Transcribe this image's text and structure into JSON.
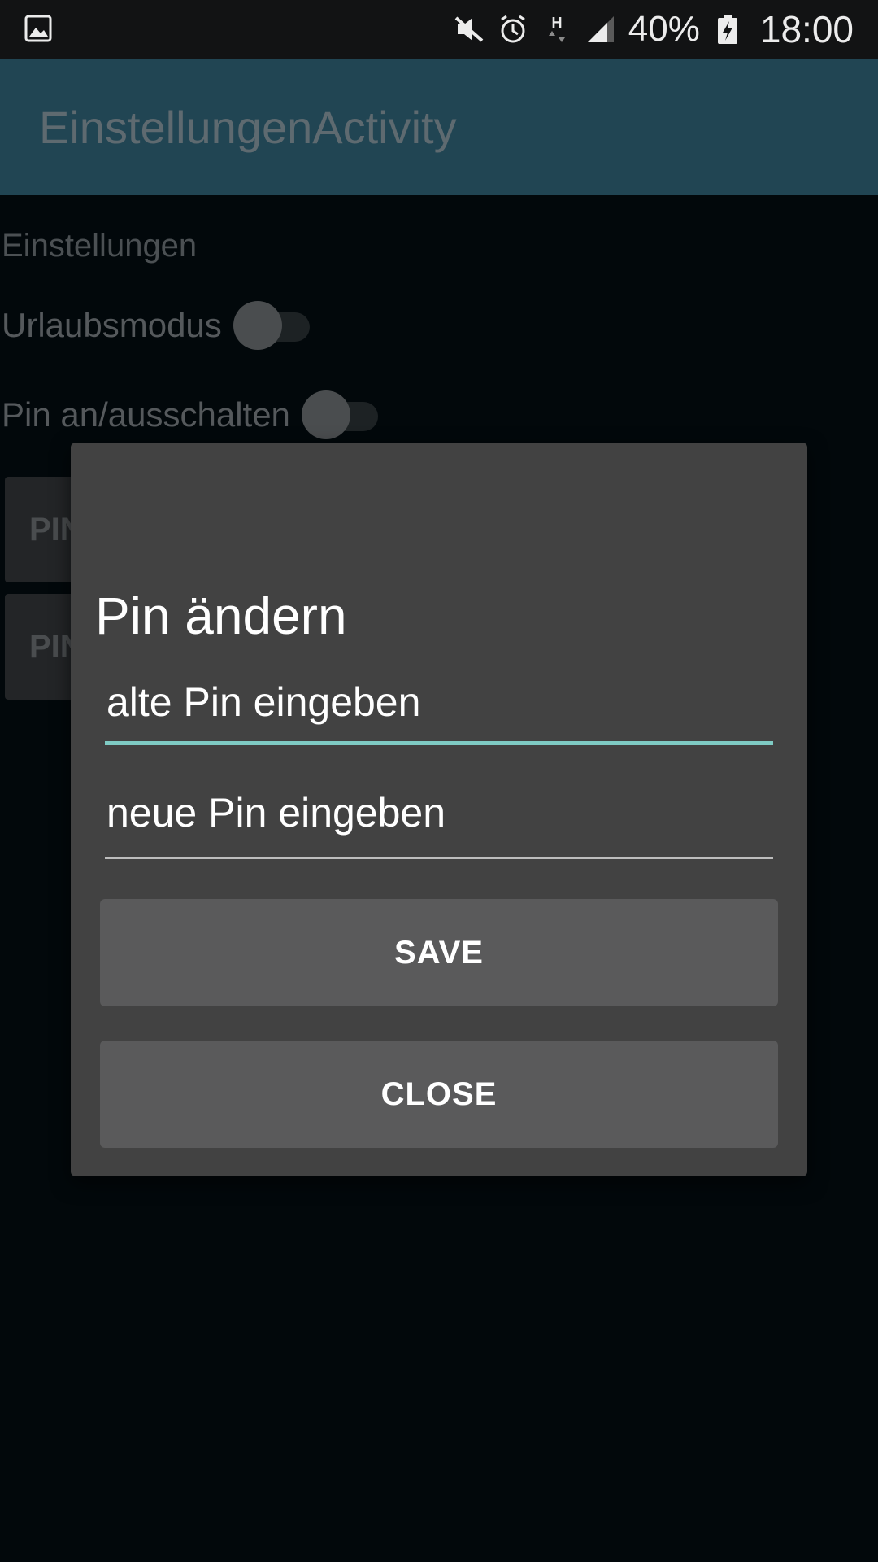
{
  "status_bar": {
    "battery_percent": "40%",
    "time": "18:00",
    "network_type": "H"
  },
  "app_bar": {
    "title": "EinstellungenActivity"
  },
  "settings": {
    "heading": "Einstellungen",
    "vacation_mode_label": "Urlaubsmodus",
    "pin_toggle_label": "Pin an/ausschalten",
    "button1_label": "PIN",
    "button2_label": "PIN"
  },
  "dialog": {
    "title": "Pin ändern",
    "old_pin_placeholder": "alte Pin eingeben",
    "new_pin_placeholder": "neue Pin eingeben",
    "save_label": "SAVE",
    "close_label": "CLOSE"
  }
}
